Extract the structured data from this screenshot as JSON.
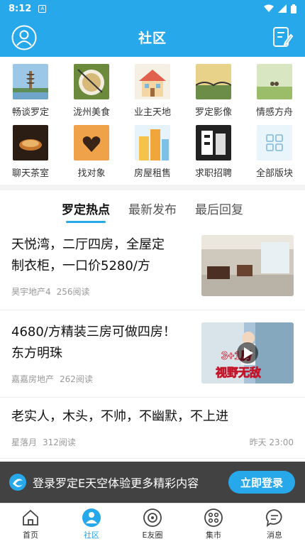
{
  "status_bar": {
    "time": "8:12",
    "notif_letter": "A"
  },
  "header": {
    "title": "社区"
  },
  "boards": [
    {
      "label": "畅谈罗定",
      "icon": "pagoda-photo"
    },
    {
      "label": "泷州美食",
      "icon": "food-bowl-photo"
    },
    {
      "label": "业主天地",
      "icon": "house-illustration"
    },
    {
      "label": "罗定影像",
      "icon": "bridge-sunset-photo"
    },
    {
      "label": "情感方舟",
      "icon": "couple-field-photo"
    },
    {
      "label": "聊天茶室",
      "icon": "tea-cup-photo"
    },
    {
      "label": "找对象",
      "icon": "heart-hands-photo"
    },
    {
      "label": "房屋租售",
      "icon": "buildings-illustration"
    },
    {
      "label": "求职招聘",
      "icon": "recruit-sign-photo"
    },
    {
      "label": "全部版块",
      "icon": "all-boards-icon"
    }
  ],
  "tabs": [
    {
      "label": "罗定热点",
      "active": true
    },
    {
      "label": "最新发布",
      "active": false
    },
    {
      "label": "最后回复",
      "active": false
    }
  ],
  "posts": [
    {
      "title_line1": "天悦湾，二厅四房，全屋定",
      "title_line2": "制衣柜，一口价5280/方",
      "author": "昊宇地产4",
      "reads": "256阅读",
      "time": "",
      "image": "apartment-interior-photo"
    },
    {
      "title_line1": "4680/方精装三房可做四房！",
      "title_line2": "东方明珠",
      "author": "嘉嘉房地产",
      "reads": "262阅读",
      "time": "",
      "image": "video-thumbnail",
      "image_text_a": "3+1房",
      "image_text_b": "视野无敌"
    },
    {
      "title_line1": "老实人，木头，不帅，不幽默，不上进",
      "title_line2": "",
      "author": "星落月",
      "reads": "312阅读",
      "time": "昨天 23:00",
      "image": ""
    }
  ],
  "login_banner": {
    "message": "登录罗定E天空体验更多精彩内容",
    "button": "立即登录"
  },
  "bottom_nav": [
    {
      "label": "首页",
      "icon": "home-icon",
      "active": false
    },
    {
      "label": "社区",
      "icon": "community-icon",
      "active": true
    },
    {
      "label": "E友圈",
      "icon": "e-circle-icon",
      "active": false
    },
    {
      "label": "集市",
      "icon": "market-icon",
      "active": false
    },
    {
      "label": "消息",
      "icon": "message-icon",
      "active": false
    }
  ],
  "colors": {
    "primary": "#27a8ea",
    "banner_bg": "#282828"
  }
}
